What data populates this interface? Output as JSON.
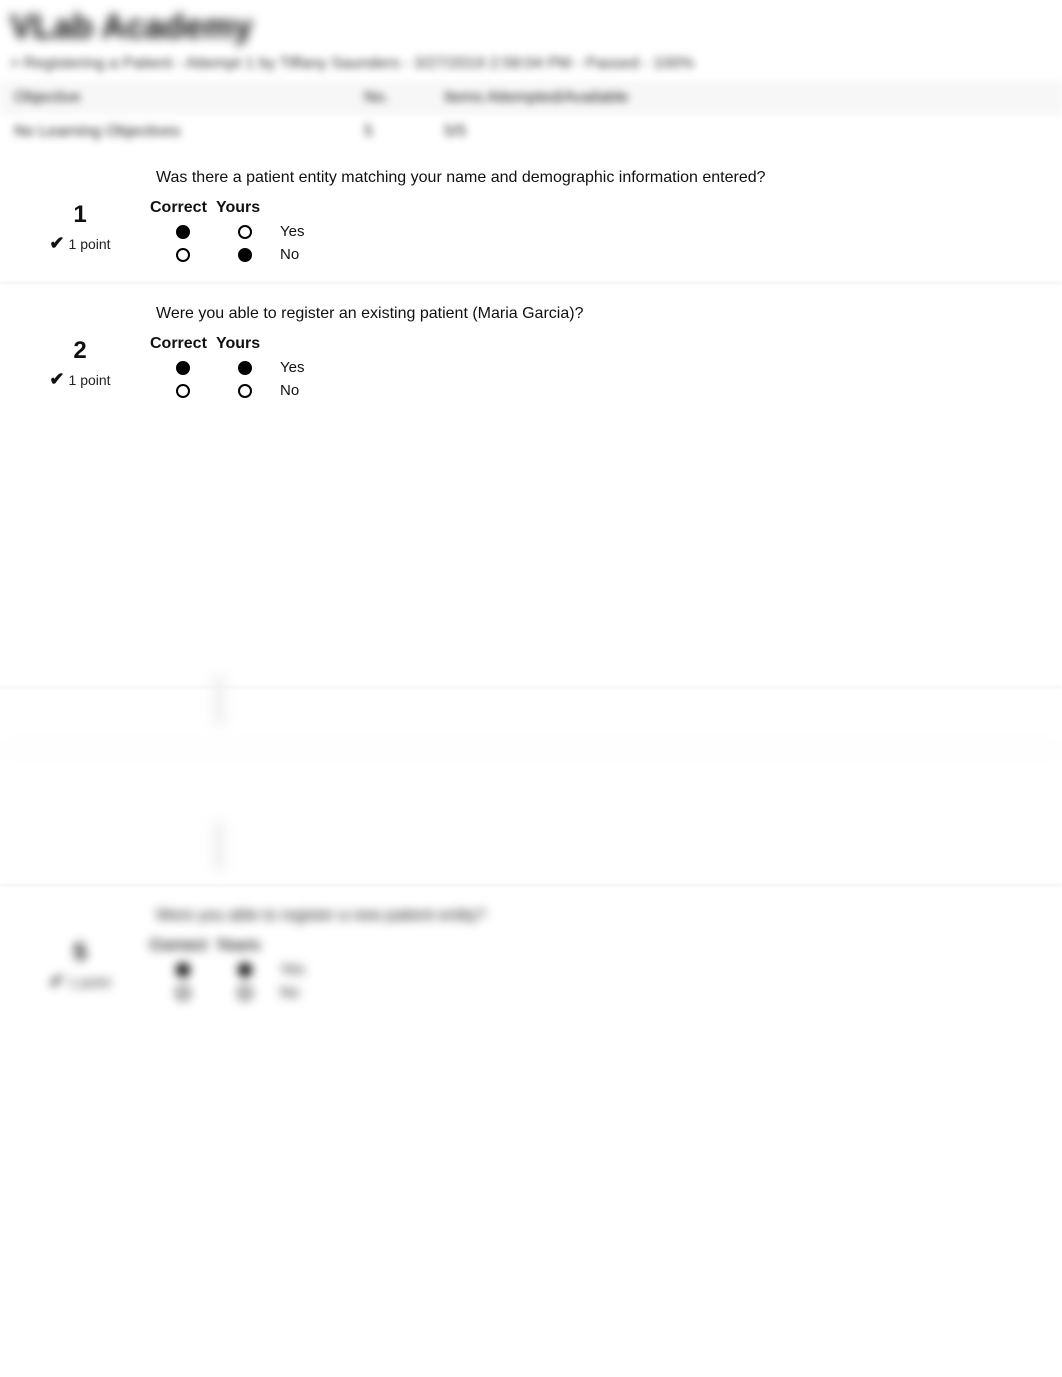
{
  "header": {
    "title": "VLab Academy"
  },
  "breadcrumb": "> Registering a Patient - Attempt 1 by Tiffany Saunders - 3/27/2019 2:58:04 PM - Passed - 100%",
  "summary": {
    "head": {
      "c1": "Objective",
      "c2": "No.",
      "c3": "Items Attempted/Available"
    },
    "body": {
      "c1": "No Learning Objectives",
      "c2": "5",
      "c3": "5/5"
    }
  },
  "columns": {
    "correct": "Correct",
    "yours": "Yours"
  },
  "options": {
    "yes": "Yes",
    "no": "No"
  },
  "points_label": "1 point",
  "questions": [
    {
      "num": "1",
      "text": "Was there a patient entity matching your name and demographic information entered?",
      "correct": "yes",
      "yours": "no"
    },
    {
      "num": "2",
      "text": "Were you able to register an existing patient (Maria Garcia)?",
      "correct": "yes",
      "yours": "yes"
    },
    {
      "num": "5",
      "text": "Were you able to register a new patient entity?",
      "correct": "yes",
      "yours": "yes"
    }
  ]
}
